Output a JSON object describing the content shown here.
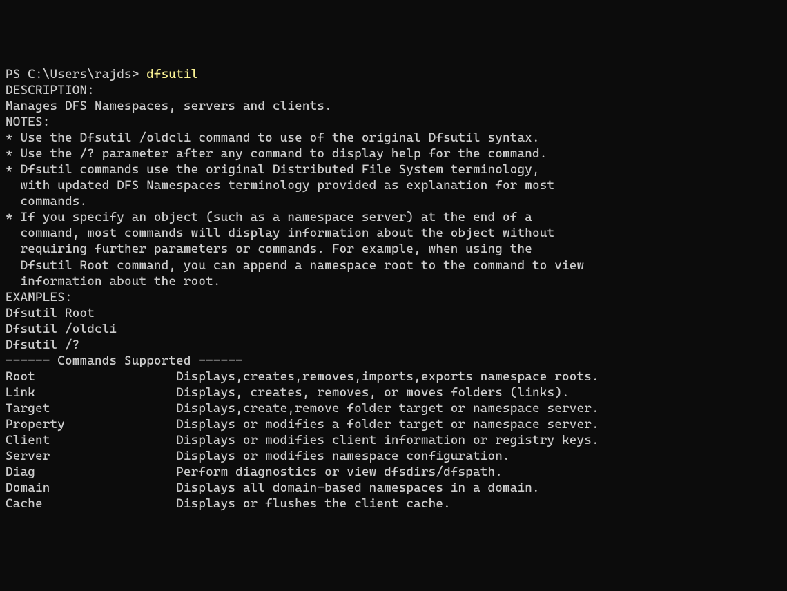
{
  "prompt": {
    "prefix": "PS C:\\Users\\rajds> ",
    "command": "dfsutil"
  },
  "blank1": "",
  "description_header": "DESCRIPTION:",
  "description_text": "Manages DFS Namespaces, servers and clients.",
  "blank2": "",
  "notes_header": "NOTES:",
  "note1": "* Use the Dfsutil /oldcli command to use of the original Dfsutil syntax.",
  "note2": "* Use the /? parameter after any command to display help for the command.",
  "note3a": "* Dfsutil commands use the original Distributed File System terminology,",
  "note3b": "  with updated DFS Namespaces terminology provided as explanation for most",
  "note3c": "  commands.",
  "note4a": "* If you specify an object (such as a namespace server) at the end of a",
  "note4b": "  command, most commands will display information about the object without",
  "note4c": "  requiring further parameters or commands. For example, when using the",
  "note4d": "  Dfsutil Root command, you can append a namespace root to the command to view",
  "note4e": "  information about the root.",
  "blank3": "",
  "examples_header": "EXAMPLES:",
  "example1": "Dfsutil Root",
  "example2": "Dfsutil /oldcli",
  "example3": "Dfsutil /?",
  "blank4": "",
  "commands_header": "------ Commands Supported ------",
  "blank5": "",
  "cmd_root": "Root                   Displays,creates,removes,imports,exports namespace roots.",
  "cmd_link": "Link                   Displays, creates, removes, or moves folders (links).",
  "cmd_target": "Target                 Displays,create,remove folder target or namespace server.",
  "cmd_property": "Property               Displays or modifies a folder target or namespace server.",
  "cmd_client": "Client                 Displays or modifies client information or registry keys.",
  "cmd_server": "Server                 Displays or modifies namespace configuration.",
  "cmd_diag": "Diag                   Perform diagnostics or view dfsdirs/dfspath.",
  "cmd_domain": "Domain                 Displays all domain-based namespaces in a domain.",
  "cmd_cache": "Cache                  Displays or flushes the client cache."
}
